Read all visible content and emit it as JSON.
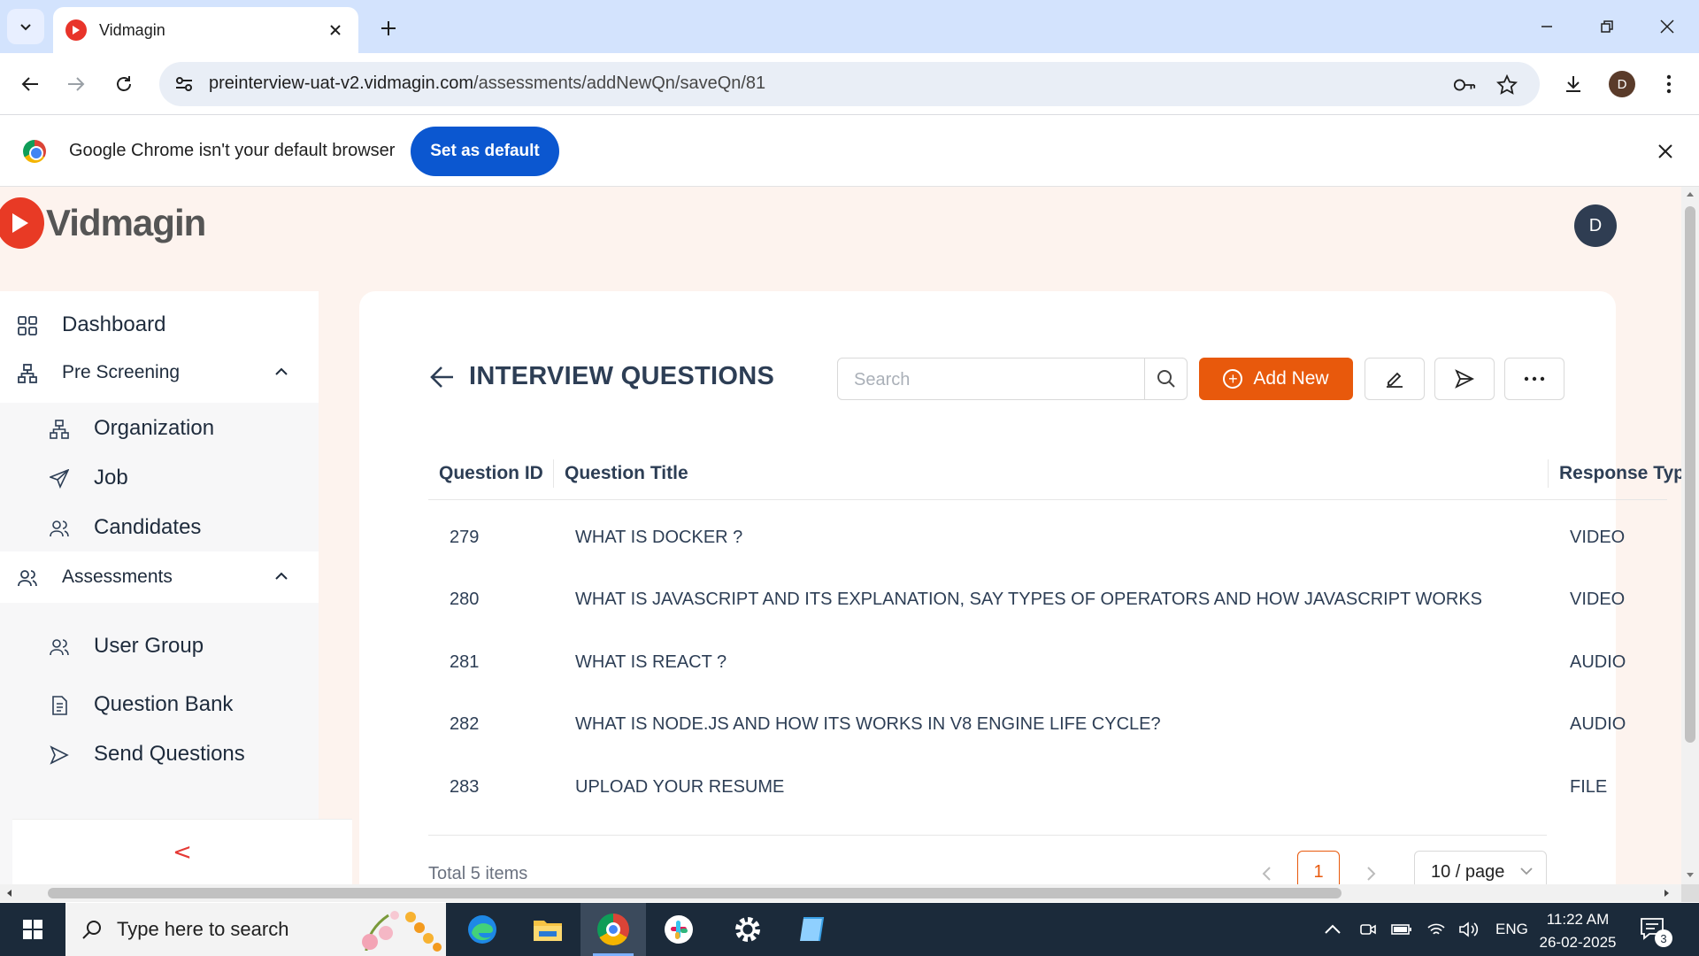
{
  "browser": {
    "tab_title": "Vidmagin",
    "url_host": "preinterview-uat-v2.vidmagin.com",
    "url_path": "/assessments/addNewQn/saveQn/81",
    "profile_initial": "D"
  },
  "infobar": {
    "message": "Google Chrome isn't your default browser",
    "button": "Set as default"
  },
  "app": {
    "logo_text": "Vidmagin",
    "brand_color": "#e8590c",
    "user_initial": "D"
  },
  "sidebar": {
    "dashboard": "Dashboard",
    "pre_screening": "Pre Screening",
    "pre_screening_items": [
      "Organization",
      "Job",
      "Candidates"
    ],
    "assessments": "Assessments",
    "assessments_items": [
      "User Group",
      "Question Bank",
      "Send Questions"
    ],
    "collapse_icon": "<"
  },
  "main": {
    "title": "INTERVIEW QUESTIONS",
    "search_placeholder": "Search",
    "add_new": "Add New",
    "columns": [
      "Question ID",
      "Question Title",
      "Response Typ"
    ],
    "rows": [
      {
        "id": "279",
        "title": "WHAT IS DOCKER ?",
        "type": "VIDEO"
      },
      {
        "id": "280",
        "title": "WHAT IS JAVASCRIPT AND ITS EXPLANATION, SAY TYPES OF OPERATORS AND HOW JAVASCRIPT WORKS",
        "type": "VIDEO"
      },
      {
        "id": "281",
        "title": "WHAT IS REACT ?",
        "type": "AUDIO"
      },
      {
        "id": "282",
        "title": "WHAT IS NODE.JS AND HOW ITS WORKS IN V8 ENGINE LIFE CYCLE?",
        "type": "AUDIO"
      },
      {
        "id": "283",
        "title": "UPLOAD YOUR RESUME",
        "type": "FILE"
      }
    ],
    "total": "Total 5 items",
    "current_page": "1",
    "page_size": "10 / page"
  },
  "taskbar": {
    "search_placeholder": "Type here to search",
    "language": "ENG",
    "time": "11:22 AM",
    "date": "26-02-2025",
    "notification_count": "3"
  }
}
